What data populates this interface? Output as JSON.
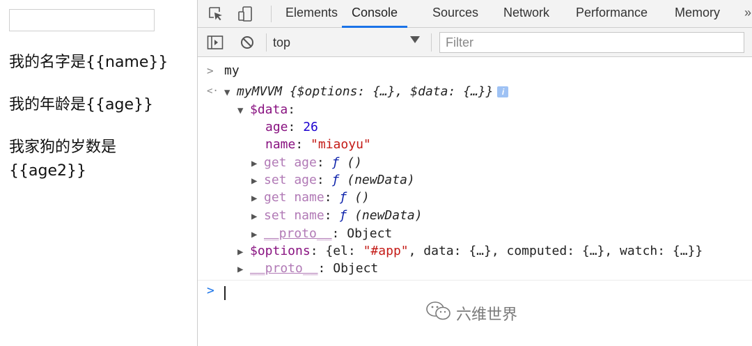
{
  "page": {
    "input_value": "",
    "line_name": "我的名字是{{name}}",
    "line_age": "我的年龄是{{age}}",
    "line_dog_1": "我家狗的岁数是",
    "line_dog_2": "{{age2}}"
  },
  "devtools": {
    "tabs": [
      "Elements",
      "Console",
      "Sources",
      "Network",
      "Performance",
      "Memory",
      "»"
    ],
    "active_tab": "Console",
    "context": "top",
    "filter_placeholder": "Filter"
  },
  "console": {
    "input_echo": "my",
    "obj_name": "myMVVM",
    "obj_preview": "{$options: {…}, $data: {…}}",
    "info_badge": "i",
    "data_key": "$data",
    "age_key": "age",
    "age_value": "26",
    "name_key": "name",
    "name_value": "\"miaoyu\"",
    "get_age_key": "get age",
    "set_age_key": "set age",
    "get_name_key": "get name",
    "set_name_key": "set name",
    "fn_glyph": "ƒ",
    "fn_empty_args": "()",
    "fn_newdata_args": "(newData)",
    "proto_key": "__proto__",
    "proto_value": "Object",
    "options_key": "$options",
    "options_preview_el_key": "el",
    "options_preview_el_value": "\"#app\"",
    "options_preview_rest": ", data: {…}, computed: {…}, watch: {…}}",
    "prompt_caret": ">"
  },
  "watermark": {
    "text": "六维世界"
  },
  "colors": {
    "accent": "#1a73e8",
    "property": "#881280",
    "number": "#1c00cf",
    "string": "#c41a16"
  }
}
